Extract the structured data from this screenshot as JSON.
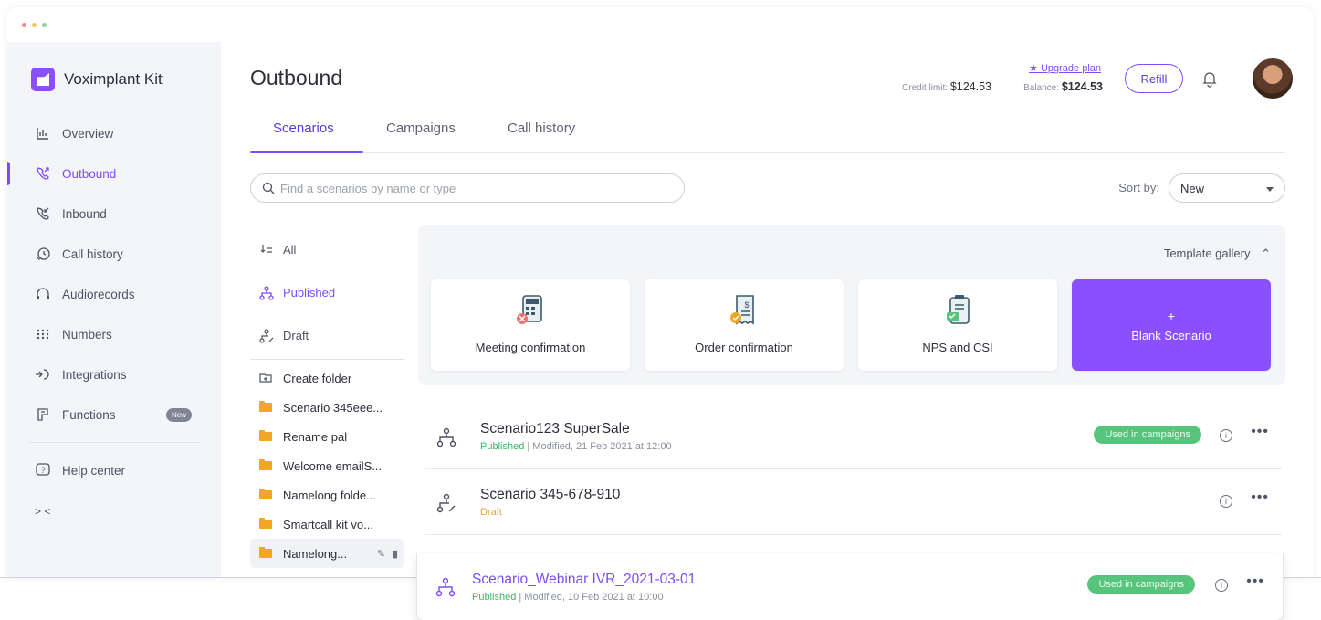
{
  "app": {
    "brand": "Voximplant Kit",
    "accent_color": "#7c4dff"
  },
  "sidebar": {
    "items": [
      {
        "label": "Overview",
        "icon": "overview-icon"
      },
      {
        "label": "Outbound",
        "icon": "outbound-call-icon",
        "active": true
      },
      {
        "label": "Inbound",
        "icon": "inbound-call-icon"
      },
      {
        "label": "Call history",
        "icon": "call-history-icon"
      },
      {
        "label": "Audiorecords",
        "icon": "headphones-icon"
      },
      {
        "label": "Numbers",
        "icon": "dialpad-icon"
      },
      {
        "label": "Integrations",
        "icon": "integrations-icon"
      },
      {
        "label": "Functions",
        "icon": "functions-icon",
        "badge": "New"
      }
    ],
    "help_label": "Help center",
    "collapse_label": "> <"
  },
  "header": {
    "title": "Outbound",
    "upgrade_label": "★ Upgrade plan",
    "credit_label": "Credit limit:",
    "credit_value": "$124.53",
    "balance_label": "Balance:",
    "balance_value": "$124.53",
    "refill_label": "Refill"
  },
  "tabs": [
    {
      "label": "Scenarios",
      "active": true
    },
    {
      "label": "Campaigns"
    },
    {
      "label": "Call history"
    }
  ],
  "search": {
    "placeholder": "Find a scenarios by name or type"
  },
  "sort": {
    "label": "Sort by:",
    "value": "New"
  },
  "filters": [
    {
      "label": "All"
    },
    {
      "label": "Published",
      "active": true
    },
    {
      "label": "Draft"
    }
  ],
  "folders": {
    "create_label": "Create folder",
    "items": [
      "Scenario 345eee...",
      "Rename pal",
      "Welcome emailS...",
      "Namelong folde...",
      "Smartcall kit vo...",
      "Namelong..."
    ]
  },
  "gallery": {
    "title": "Template gallery",
    "cards": [
      {
        "label": "Meeting confirmation"
      },
      {
        "label": "Order confirmation"
      },
      {
        "label": "NPS and CSI"
      }
    ],
    "blank_plus": "+",
    "blank_label": "Blank Scenario"
  },
  "scenarios": [
    {
      "name": "Scenario123 SuperSale",
      "status": "Published",
      "modified": " | Modified, 21 Feb 2021 at 12:00",
      "badge": "Used in campaigns"
    },
    {
      "name": "Scenario 345-678-910",
      "status": "Draft",
      "modified": "",
      "badge": ""
    },
    {
      "name": "Scenario_Webinar IVR_2021-03-01",
      "status": "Published",
      "modified": " | Modified, 10 Feb 2021 at 10:00",
      "badge": "Used in campaigns"
    }
  ]
}
